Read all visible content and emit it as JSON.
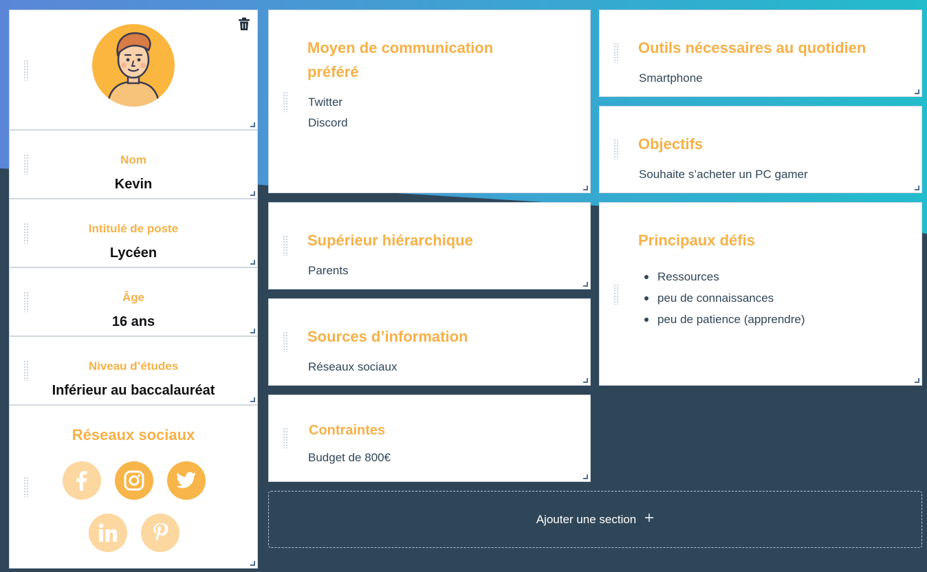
{
  "colors": {
    "accent": "#f5b148",
    "background_dark": "#2f4659",
    "gradient_start": "#5b86d8",
    "gradient_end": "#22bccc",
    "text_dark": "#2f4659"
  },
  "profile": {
    "avatar_icon": "user-avatar-icon",
    "delete_icon": "trash-icon",
    "fields": [
      {
        "label": "Nom",
        "value": "Kevin"
      },
      {
        "label": "Intitulé de poste",
        "value": "Lycéen"
      },
      {
        "label": "Âge",
        "value": "16 ans"
      },
      {
        "label": "Niveau d’études",
        "value": "Inférieur au baccalauréat"
      }
    ],
    "social_title": "Réseaux sociaux",
    "social_icons": [
      "facebook-icon",
      "instagram-icon",
      "twitter-icon",
      "linkedin-icon",
      "pinterest-icon"
    ]
  },
  "sections": {
    "communication": {
      "title_line1": "Moyen de communication",
      "title_line2": "préféré",
      "items": [
        "Twitter",
        "Discord"
      ]
    },
    "outils": {
      "title": "Outils nécessaires au quotidien",
      "text": "Smartphone"
    },
    "objectifs": {
      "title": "Objectifs",
      "text": "Souhaite s’acheter un PC gamer"
    },
    "superieur": {
      "title": "Supérieur hiérarchique",
      "text": "Parents"
    },
    "defis": {
      "title": "Principaux défis",
      "items": [
        "Ressources",
        "peu de connaissances",
        "peu de patience (apprendre)"
      ]
    },
    "sources": {
      "title": "Sources d’information",
      "text": "Réseaux sociaux"
    },
    "contraintes": {
      "title": "Contraintes",
      "text": "Budget de 800€"
    }
  },
  "add_section": {
    "label": "Ajouter une section",
    "icon": "plus-icon"
  }
}
